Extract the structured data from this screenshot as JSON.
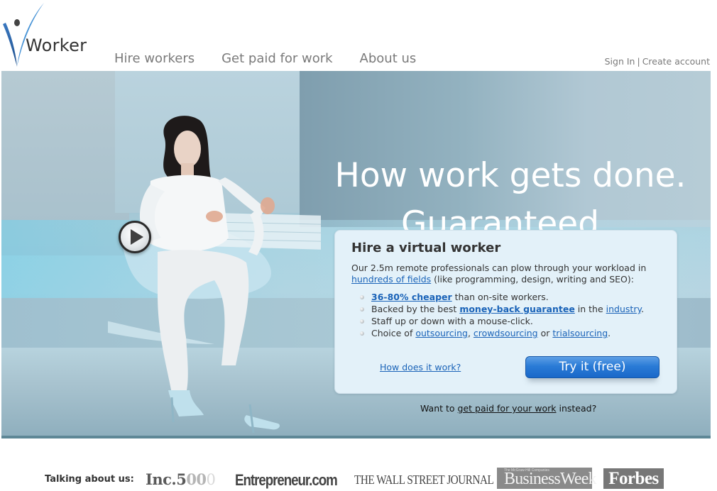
{
  "brand": {
    "name": "Worker",
    "logo_icon": "v-checkmark-person-logo",
    "logo_colors": {
      "dark": "#2a5fa0",
      "light": "#4a9ad8",
      "head": "#444444"
    }
  },
  "nav": {
    "items": [
      {
        "label": "Hire workers"
      },
      {
        "label": "Get paid for work"
      },
      {
        "label": "About us"
      }
    ]
  },
  "account": {
    "sign_in": "Sign In",
    "separator": "|",
    "create_account": "Create account"
  },
  "hero": {
    "headline_line1": "How work gets done.",
    "headline_line2": "Guaranteed.",
    "play_icon": "play-video-icon",
    "card": {
      "title": "Hire a virtual worker",
      "intro_text_before": "Our 2.5m remote professionals can plow through your workload in ",
      "intro_link": "hundreds of fields",
      "intro_text_after": " (like programming, design, writing and SEO):",
      "bullets": [
        {
          "link": "36-80% cheaper",
          "text_after": " than on-site workers."
        },
        {
          "text_before": "Backed by the best ",
          "link": "money-back guarantee",
          "text_mid": " in the ",
          "link2": "industry",
          "text_after": "."
        },
        {
          "text": "Staff up or down with a mouse-click."
        },
        {
          "text_before": "Choice of ",
          "link": "outsourcing",
          "sep1": ", ",
          "link2": "crowdsourcing",
          "sep2": " or ",
          "link3": "trialsourcing",
          "text_after": "."
        }
      ],
      "how_link": "How does it work?",
      "cta_button": "Try it (free)"
    },
    "alt_prompt_before": "Want to ",
    "alt_prompt_link": "get paid for your work",
    "alt_prompt_after": " instead?"
  },
  "press": {
    "label": "Talking about us:",
    "logos": {
      "inc_main": "Inc.5",
      "inc_faded": "00",
      "inc_last": "0",
      "entrepreneur": "Entrepreneur.com",
      "wsj": "THE WALL STREET JOURNAL",
      "businessweek_tagline": "The McGraw-Hill Companies",
      "businessweek": "BusinessWeek",
      "forbes": "Forbes"
    }
  },
  "colors": {
    "link": "#1a63b8",
    "nav_text": "#7a7a7a",
    "card_bg": "#e3f1f9",
    "cta_bg": "#2a7bd6",
    "hero_bottom_bar": "#5e8796"
  }
}
